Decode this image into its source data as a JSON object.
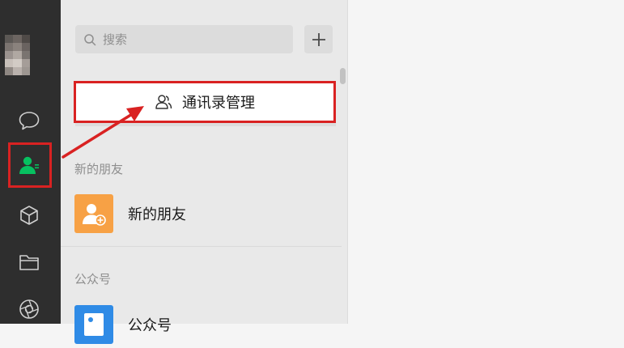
{
  "colors": {
    "rail_bg": "#2e2e2e",
    "accent_green": "#07c160",
    "highlight_red": "#d92222",
    "new_friends_orange": "#f7a145",
    "official_blue": "#2f8be6"
  },
  "rail": {
    "items": [
      {
        "icon": "chat-bubble-icon"
      },
      {
        "icon": "contacts-icon",
        "active": true
      },
      {
        "icon": "cube-icon"
      },
      {
        "icon": "folder-icon"
      },
      {
        "icon": "aperture-icon"
      }
    ]
  },
  "search": {
    "placeholder": "搜索"
  },
  "add_button": {
    "label": "+"
  },
  "contacts": {
    "manage_label": "通讯录管理",
    "new_friends_section": "新的朋友",
    "new_friends_item": "新的朋友",
    "official_section": "公众号",
    "official_item": "公众号"
  }
}
